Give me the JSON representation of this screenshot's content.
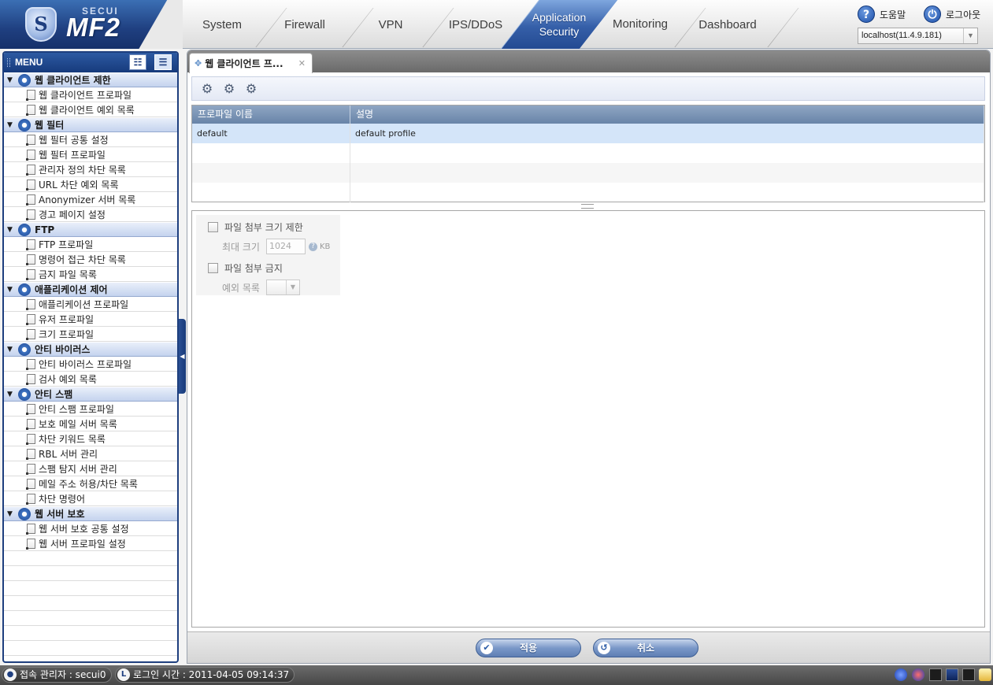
{
  "brand": {
    "mark": "S",
    "vendor": "SECUI",
    "product": "MF2"
  },
  "nav": {
    "tabs": [
      {
        "label": "System"
      },
      {
        "label": "Firewall"
      },
      {
        "label": "VPN"
      },
      {
        "label": "IPS/DDoS"
      },
      {
        "label_line1": "Application",
        "label_line2": "Security",
        "active": true
      },
      {
        "label": "Monitoring"
      },
      {
        "label": "Dashboard"
      }
    ]
  },
  "top_right": {
    "help_label": "도움말",
    "logout_label": "로그아웃",
    "server": "localhost(11.4.9.181)"
  },
  "sidebar": {
    "title": "MENU",
    "groups": [
      {
        "label": "웹 클라이언트 제한",
        "items": [
          "웹 클라이언트 프로파일",
          "웹 클라이언트 예외 목록"
        ]
      },
      {
        "label": "웹 필터",
        "items": [
          "웹 필터 공통 설정",
          "웹 필터 프로파일",
          "관리자 정의 차단 목록",
          "URL 차단 예외 목록",
          "Anonymizer 서버 목록",
          "경고 페이지 설정"
        ]
      },
      {
        "label": "FTP",
        "items": [
          "FTP 프로파일",
          "명령어 접근 차단 목록",
          "금지 파일 목록"
        ]
      },
      {
        "label": "애플리케이션 제어",
        "items": [
          "애플리케이션 프로파일",
          "유저 프로파일",
          "크기 프로파일"
        ]
      },
      {
        "label": "안티 바이러스",
        "items": [
          "안티 바이러스 프로파일",
          "검사 예외 목록"
        ]
      },
      {
        "label": "안티 스팸",
        "items": [
          "안티 스팸 프로파일",
          "보호 메일 서버 목록",
          "차단 키워드 목록",
          "RBL 서버 관리",
          "스팸 탐지 서버 관리",
          "메일 주소 허용/차단 목록",
          "차단 명령어"
        ]
      },
      {
        "label": "웹 서버 보호",
        "items": [
          "웹 서버 보호 공통 설정",
          "웹 서버 프로파일 설정"
        ]
      }
    ]
  },
  "main": {
    "tab_title": "웹 클라이언트 프...",
    "grid": {
      "columns": [
        "프로파일 이름",
        "설명"
      ],
      "rows": [
        {
          "name": "default",
          "desc": "default profile"
        }
      ]
    },
    "form": {
      "size_limit_label": "파일 첨부 크기 제한",
      "max_size_label": "최대 크기",
      "max_size_value": "1024",
      "max_size_unit": "KB",
      "block_attach_label": "파일 첨부 금지",
      "exception_label": "예외 목록"
    },
    "buttons": {
      "apply": "적용",
      "cancel": "취소"
    }
  },
  "status": {
    "admin_label": "접속 관리자 : secui0",
    "login_time_label": "로그인 시간 : 2011-04-05 09:14:37"
  },
  "colors": {
    "accent": "#1e3f7e",
    "active_tab": "#355fa8",
    "selected_row": "#d4e5f9"
  }
}
